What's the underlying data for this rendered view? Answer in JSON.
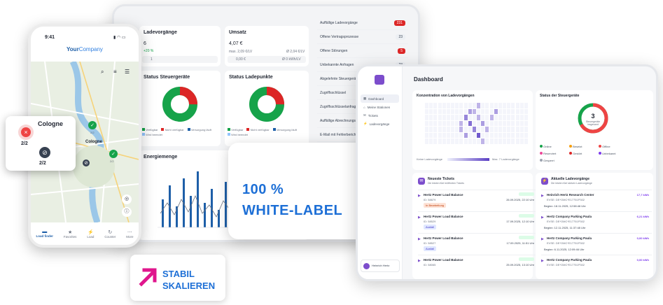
{
  "back_dashboard": {
    "ladevorgaenge": {
      "title": "Ladevorgänge",
      "value": "6",
      "change": "+20 %",
      "row_value": "1"
    },
    "umsatz": {
      "title": "Umsatz",
      "value": "4,07 €",
      "max_label": "max. 2,09 €/LV",
      "avg": "Ø 2,04 €/LV",
      "row_value": "0,00 €",
      "row_right": "Ø 0 kWh/LV"
    },
    "steuergeraete": {
      "title": "Status Steuergeräte",
      "legend": [
        "Verfügbar",
        "Nicht verfügbar",
        "Versorgung läuft",
        "Wird beendet"
      ]
    },
    "ladepunkte": {
      "title": "Status Ladepunkte",
      "legend": [
        "Verfügbar",
        "Nicht verfügbar",
        "Versorgung läuft",
        "Wird beendet"
      ]
    },
    "energie": {
      "title": "Energiemenge"
    },
    "side_rows": [
      {
        "label": "Auffällige Ladevorgänge",
        "count": "231",
        "alert": true
      },
      {
        "label": "Offene Vertragsprozesse",
        "count": "23",
        "alert": false
      },
      {
        "label": "Offene Störungen",
        "count": "5",
        "alert": true
      },
      {
        "label": "Unbekannte Anfragen",
        "count": "23",
        "alert": false
      },
      {
        "label": "Abgelehnte Steuergeräte",
        "count": "",
        "alert": false
      },
      {
        "label": "Zugriffsschlüssel",
        "count": "",
        "alert": false
      },
      {
        "label": "Zugriffsschlüsselanfragen",
        "count": "",
        "alert": false
      },
      {
        "label": "Auffällige Abrechnungsläufe",
        "count": "",
        "alert": false
      },
      {
        "label": "E-Mail mit Fehlerbericht",
        "count": "",
        "alert": false
      },
      {
        "label": "offene Provider Anfragen",
        "count": "",
        "alert": false
      },
      {
        "label": "offene Operator Anfragen",
        "count": "",
        "alert": false
      },
      {
        "label": "Output Management Fehler",
        "count": "",
        "alert": false
      }
    ]
  },
  "phone": {
    "time": "9:41",
    "brand_prefix": "Your",
    "brand_suffix": "Company",
    "map_labels": [
      "Cologne",
      "Cologne"
    ],
    "pin_counts": [
      "2/2",
      "2/2",
      "2/2"
    ],
    "nav": [
      "Load finder",
      "Favorites",
      "Load",
      "Counter",
      "More"
    ]
  },
  "popup": {
    "title": "Cologne",
    "count_a": "2/2",
    "count_b": "2/2"
  },
  "white_label": {
    "line1": "100 %",
    "line2": "WHITE-LABEL"
  },
  "stabil": {
    "line1": "STABIL",
    "line2": "SKALIEREN"
  },
  "front_dashboard": {
    "title": "Dashboard",
    "nav": [
      "Dashboard",
      "Meine Stationen",
      "Tickets",
      "Ladevorgänge"
    ],
    "heatmap_title": "Konzentration von Ladevorgängen",
    "heatmap_legend_left": "Keine Ladevorgänge",
    "heatmap_legend_right": "Max. 7 Ladevorgänge",
    "status_title": "Status der Steuergeräte",
    "status_count": "3",
    "status_sub": "Steuergeräte insgesamt",
    "status_legend": [
      "Online",
      "Besetzt",
      "Offline",
      "Reserviert",
      "Gestört",
      "Unbekannt",
      "Gesperrt"
    ],
    "tickets_title": "Neueste Tickets",
    "tickets_sub": "Die letzten fünf eröffneten Tickets",
    "tickets": [
      {
        "name": "Hertz Power Load Balance",
        "id": "ID: 58879",
        "date": "26.09.2025, 22:10 Uhr",
        "tag": "In Bearbeitung"
      },
      {
        "name": "Hertz Power Load Balance",
        "id": "ID: 58529",
        "date": "17.09.2025, 12:10 Uhr",
        "tag": "Ausfall"
      },
      {
        "name": "Hertz Power Load Balance",
        "id": "ID: 58527",
        "date": "17.09.2025, 11:51 Uhr",
        "tag": "Ausfall"
      },
      {
        "name": "Hertz Power Load Balance",
        "id": "ID: 58065",
        "date": "25.09.2025, 13:10 Uhr",
        "tag": ""
      }
    ],
    "charging_title": "Aktuelle Ladevorgänge",
    "charging_sub": "Die letzten fünf aktiven Ladevorgänge",
    "charging": [
      {
        "name": "Heinrich Hertz Research Center",
        "evse": "EVSE: DE*OMC*E17751P302",
        "value": "17,7 kWh",
        "start": "Beginn: 18.11.2025, 12:58:46 Uhr"
      },
      {
        "name": "Hertz Company Parking Paula",
        "evse": "EVSE: DE*OMC*E17751P302",
        "value": "6,21 kWh",
        "start": "Beginn: 12.11.2025, 11:37:48 Uhr"
      },
      {
        "name": "Hertz Company Parking Paula",
        "evse": "EVSE: DE*OMC*E17751P302",
        "value": "0,00 kWh",
        "start": "Beginn: 6.11.2025, 12:09:46 Uhr"
      },
      {
        "name": "Hertz Company Parking Paula",
        "evse": "EVSE: DE*OMC*E17751P302",
        "value": "0,00 kWh",
        "start": ""
      }
    ],
    "user_name": "Heinrich Hertz"
  }
}
